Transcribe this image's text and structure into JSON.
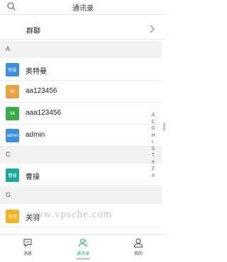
{
  "header": {
    "title": "通讯录",
    "search_icon": "search-icon"
  },
  "group_chat": {
    "label": "群聊",
    "chevron_icon": "chevron-right-icon"
  },
  "sections": [
    {
      "letter": "A",
      "contacts": [
        {
          "avatar_text": "特曼",
          "avatar_color": "#3d8ee0",
          "name": "奥特曼"
        },
        {
          "avatar_text": "56",
          "avatar_color": "#e8a33d",
          "name": "aa123456"
        },
        {
          "avatar_text": "56",
          "avatar_color": "#3aaa4b",
          "name": "aaa123456"
        },
        {
          "avatar_text": "admin",
          "avatar_color": "#3d8ee0",
          "name": "admin"
        }
      ]
    },
    {
      "letter": "C",
      "contacts": [
        {
          "avatar_text": "曹操",
          "avatar_color": "#1aaa9c",
          "name": "曹操"
        }
      ]
    },
    {
      "letter": "G",
      "contacts": [
        {
          "avatar_text": "关羽",
          "avatar_color": "#f0b520",
          "name": "关羽"
        }
      ]
    }
  ],
  "index_letters": [
    "A",
    "C",
    "G",
    "H",
    "L",
    "S",
    "T",
    "X",
    "Z",
    "#"
  ],
  "watermark": "www.vpsche.com",
  "tabbar": {
    "tabs": [
      {
        "label": "消息",
        "icon": "message-icon",
        "active": false
      },
      {
        "label": "通讯录",
        "icon": "contacts-icon",
        "active": true
      },
      {
        "label": "我的",
        "icon": "profile-icon",
        "active": false
      }
    ],
    "active_color": "#1aad6e"
  }
}
